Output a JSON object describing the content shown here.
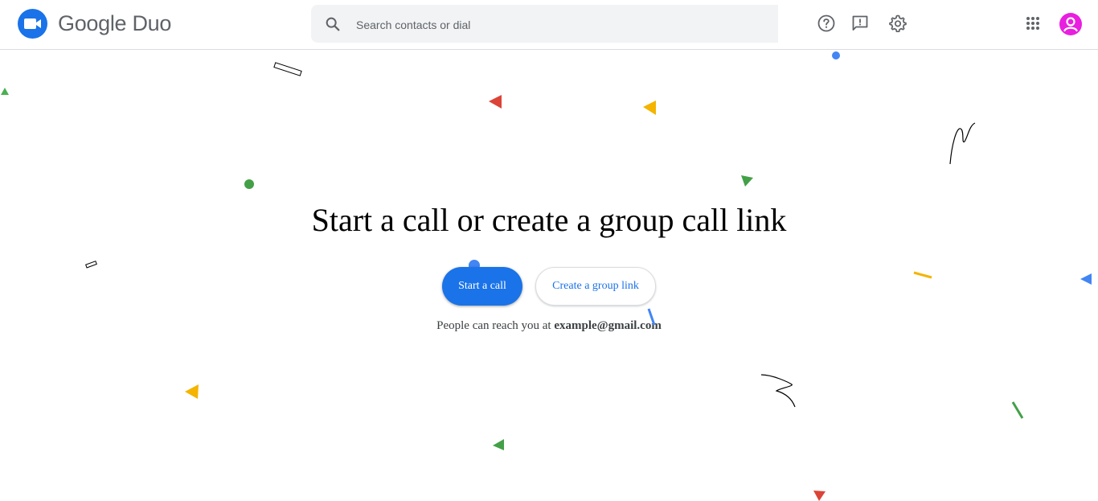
{
  "app": {
    "name": "Google Duo"
  },
  "search": {
    "placeholder": "Search contacts or dial"
  },
  "toolbar": {
    "icons": [
      "help-icon",
      "feedback-icon",
      "settings-icon",
      "apps-grid-icon",
      "account-avatar"
    ]
  },
  "main": {
    "headline": "Start a call or create a group call link",
    "start_call_label": "Start a call",
    "group_link_label": "Create a group link",
    "reach_prefix": "People can reach you at",
    "reach_email": "example@gmail.com"
  },
  "colors": {
    "brand_blue": "#1a73e8",
    "avatar": "#e91ee0",
    "confetti_red": "#db4437",
    "confetti_yellow": "#f4b400",
    "confetti_green": "#0f9d58",
    "confetti_blue": "#4285f4"
  }
}
